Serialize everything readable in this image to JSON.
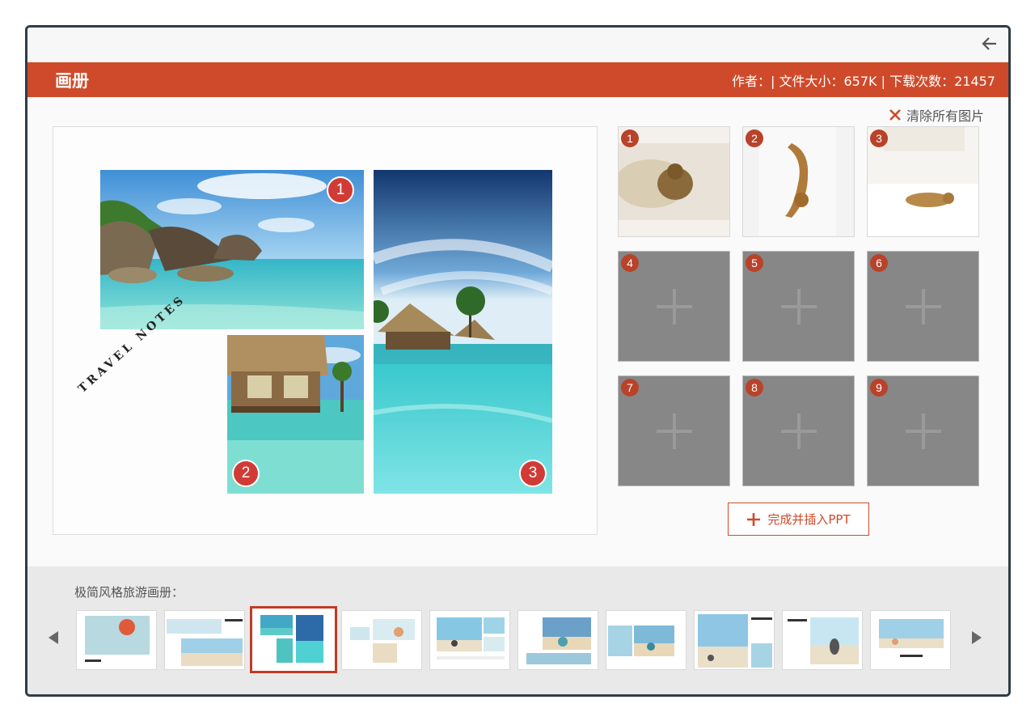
{
  "window": {
    "title": "画册",
    "meta": "作者：| 文件大小：657K | 下载次数：21457"
  },
  "toolbar": {
    "clear_label": "清除所有图片",
    "finish_label": "完成并插入PPT"
  },
  "preview": {
    "decor_text": "TRAVEL NOTES",
    "badges": [
      "1",
      "2",
      "3"
    ]
  },
  "slots": [
    {
      "num": "1",
      "filled": true,
      "desc": "cat on knit blanket"
    },
    {
      "num": "2",
      "filled": true,
      "desc": "cat lying on bed"
    },
    {
      "num": "3",
      "filled": true,
      "desc": "cat on white bed"
    },
    {
      "num": "4",
      "filled": false
    },
    {
      "num": "5",
      "filled": false
    },
    {
      "num": "6",
      "filled": false
    },
    {
      "num": "7",
      "filled": false
    },
    {
      "num": "8",
      "filled": false
    },
    {
      "num": "9",
      "filled": false
    }
  ],
  "templates": {
    "label": "极简风格旅游画册：",
    "selected_index": 2,
    "count": 10
  },
  "colors": {
    "accent": "#cf4a2a",
    "badge": "#d13b36",
    "empty_slot": "#878787"
  }
}
